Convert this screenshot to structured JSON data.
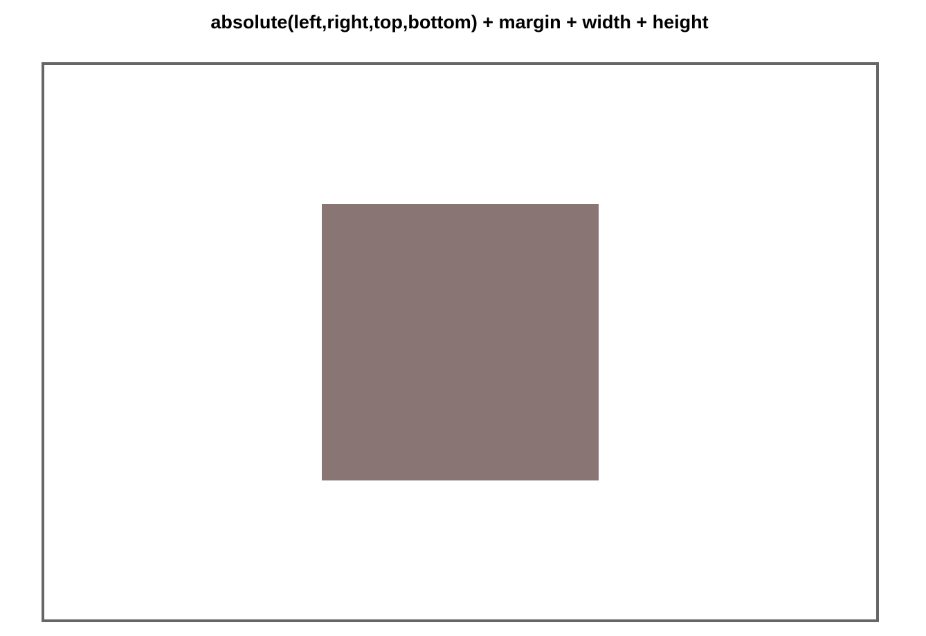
{
  "page": {
    "title": "absolute(left,right,top,bottom) + margin + width + height"
  },
  "colors": {
    "background": "#ffffff",
    "container_border": "#666666",
    "box_fill": "#897574",
    "title_text": "#000000"
  }
}
